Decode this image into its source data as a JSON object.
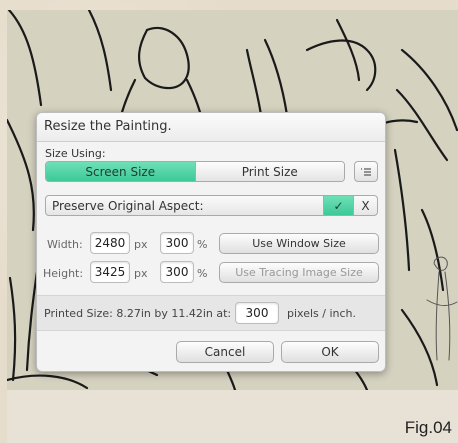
{
  "dialog": {
    "title": "Resize the Painting.",
    "size_using_label": "Size Using:",
    "tabs": [
      {
        "label": "Screen Size",
        "active": true
      },
      {
        "label": "Print Size",
        "active": false
      }
    ],
    "menu_icon": "list-icon",
    "aspect": {
      "label": "Preserve Original Aspect:",
      "confirm_symbol": "✓",
      "cancel_symbol": "X",
      "checked": true
    },
    "width": {
      "label": "Width:",
      "px_value": "2480",
      "px_unit": "px",
      "percent_value": "300",
      "percent_unit": "%"
    },
    "height": {
      "label": "Height:",
      "px_value": "3425",
      "px_unit": "px",
      "percent_value": "300",
      "percent_unit": "%"
    },
    "use_window_size_label": "Use Window Size",
    "use_tracing_image_size_label": "Use Tracing Image Size",
    "printed": {
      "text": "Printed Size: 8.27in by 11.42in at:",
      "resolution": "300",
      "unit_text": "pixels / inch."
    },
    "cancel_label": "Cancel",
    "ok_label": "OK"
  },
  "figure_label": "Fig.04",
  "colors": {
    "accent": "#4ccf9f",
    "canvas": "#d5d2c0",
    "frame": "#e6dccb"
  }
}
